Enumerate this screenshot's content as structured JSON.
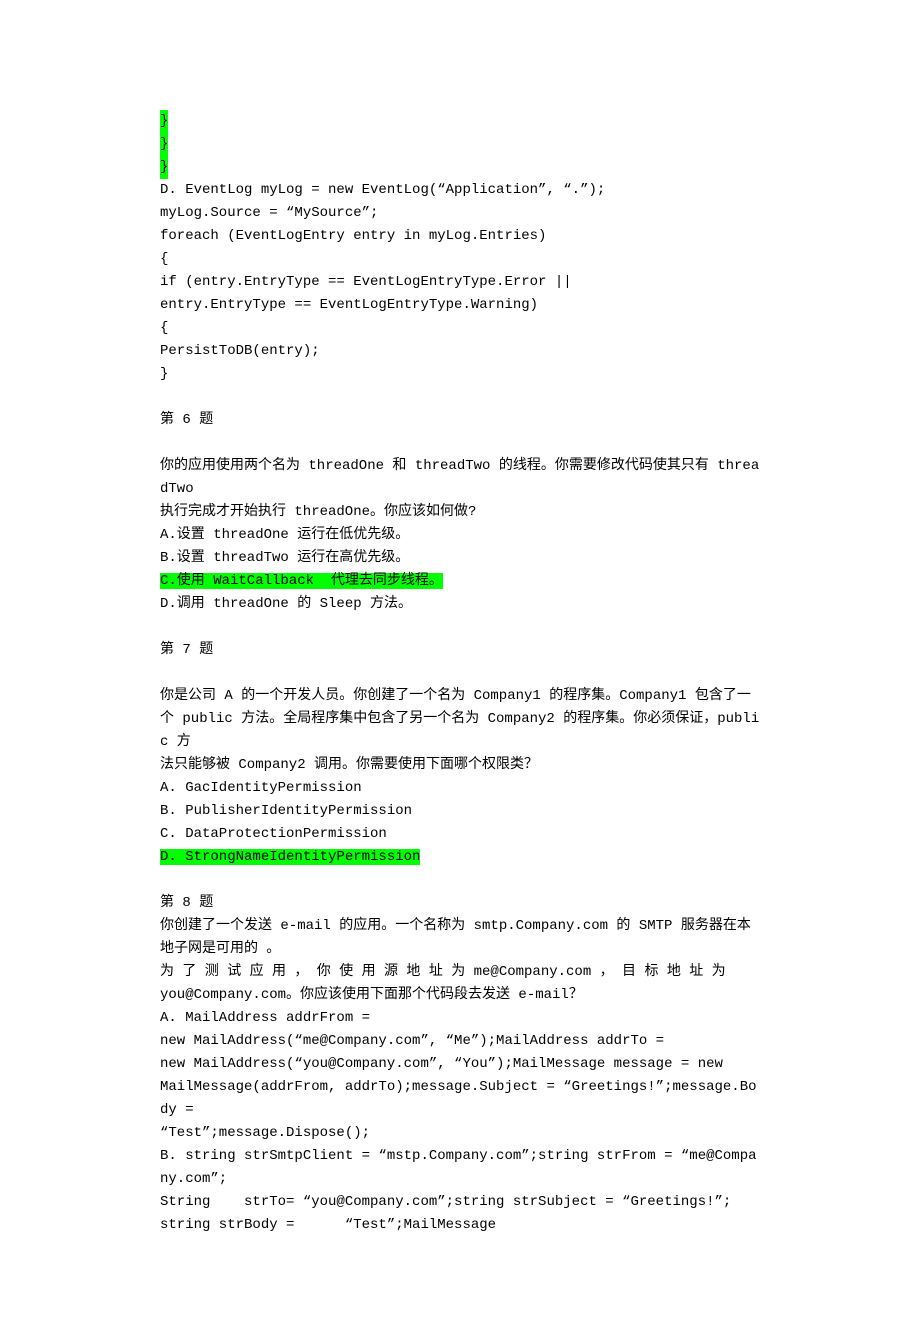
{
  "pre": {
    "hl1": "}",
    "hl2": "}",
    "hl3": "}",
    "d1": "D. EventLog myLog = new EventLog(“Application”, “.”);",
    "d2": "myLog.Source = “MySource”;",
    "d3": "foreach (EventLogEntry entry in myLog.Entries)",
    "d4": "{",
    "d5": "if (entry.EntryType == EventLogEntryType.Error ||",
    "d6": "entry.EntryType == EventLogEntryType.Warning)",
    "d7": "{",
    "d8": "PersistToDB(entry);",
    "d9": "}"
  },
  "q6": {
    "title": "第 6 题",
    "body1": "你的应用使用两个名为 threadOne 和 threadTwo 的线程。你需要修改代码使其只有 threadTwo",
    "body2": "执行完成才开始执行 threadOne。你应该如何做?",
    "a": "A.设置 threadOne 运行在低优先级。",
    "b": "B.设置 threadTwo 运行在高优先级。",
    "c": "C.使用 WaitCallback  代理去同步线程。",
    "d": "D.调用 threadOne 的 Sleep 方法。"
  },
  "q7": {
    "title": "第 7 题",
    "body1": "你是公司 A 的一个开发人员。你创建了一个名为 Company1 的程序集。Company1 包含了一",
    "body2": "个 public 方法。全局程序集中包含了另一个名为 Company2 的程序集。你必须保证，public 方",
    "body3": "法只能够被 Company2 调用。你需要使用下面哪个权限类？",
    "a": "A. GacIdentityPermission",
    "b": "B. PublisherIdentityPermission",
    "c": "C. DataProtectionPermission",
    "d": "D. StrongNameIdentityPermission"
  },
  "q8": {
    "title": "第 8 题",
    "body1": "你创建了一个发送 e-mail 的应用。一个名称为 smtp.Company.com 的 SMTP 服务器在本地子网是可用的 。",
    "body2": "为 了 测 试 应 用 ， 你 使 用 源 地 址 为 me@Company.com ， 目 标 地 址 为",
    "body3": "you@Company.com。你应该使用下面那个代码段去发送 e-mail？",
    "a1": "A. MailAddress addrFrom =",
    "a2": "new MailAddress(“me@Company.com”, “Me”);MailAddress addrTo =",
    "a3": "new MailAddress(“you@Company.com”, “You”);MailMessage message = new",
    "a4": "MailMessage(addrFrom, addrTo);message.Subject = “Greetings!”;message.Body =",
    "a5": "“Test”;message.Dispose();",
    "b1": "B. string strSmtpClient = “mstp.Company.com”;string strFrom = “me@Company.com”;",
    "b2": "String    strTo= “you@Company.com”;string strSubject = “Greetings!”;",
    "b3": "string strBody =      “Test”;MailMessage"
  }
}
